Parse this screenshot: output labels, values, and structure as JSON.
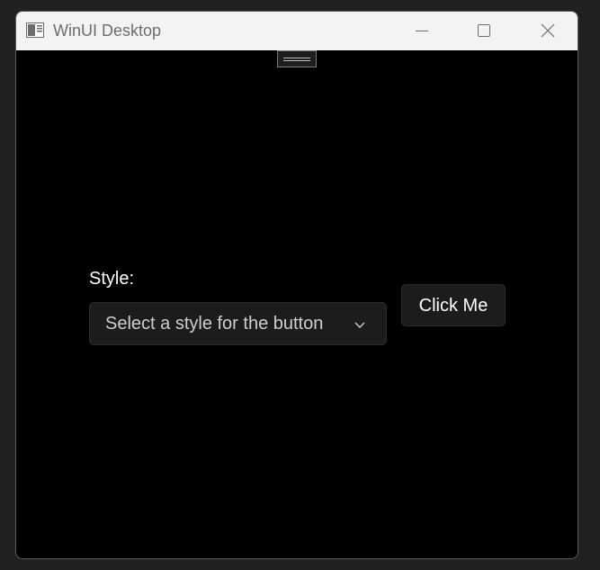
{
  "window": {
    "title": "WinUI Desktop",
    "app_icon": "app-window-icon",
    "controls": {
      "minimize_icon": "minimize-icon",
      "maximize_icon": "maximize-icon",
      "close_icon": "close-icon"
    },
    "colors": {
      "titlebar_bg": "#f3f3f3",
      "content_bg": "#000000",
      "control_bg": "#1c1c1c"
    }
  },
  "content": {
    "drag_handle_icon": "drag-handle-icon",
    "style_label": "Style:",
    "combo": {
      "placeholder": "Select a style for the button",
      "chevron_icon": "chevron-down-icon"
    },
    "button": {
      "label": "Click Me"
    }
  }
}
